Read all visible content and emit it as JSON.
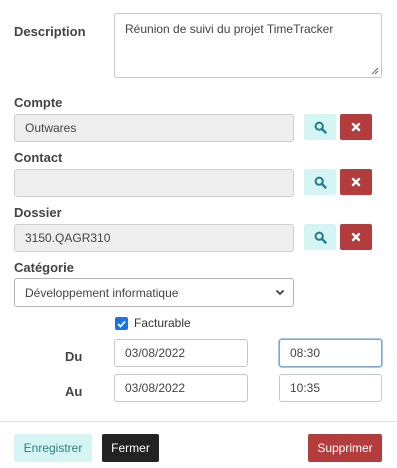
{
  "description": {
    "label": "Description",
    "value": "Réunion de suivi du projet TimeTracker"
  },
  "compte": {
    "label": "Compte",
    "value": "Outwares"
  },
  "contact": {
    "label": "Contact",
    "value": ""
  },
  "dossier": {
    "label": "Dossier",
    "value": "3150.QAGR310"
  },
  "categorie": {
    "label": "Catégorie",
    "selected": "Développement informatique"
  },
  "facturable": {
    "label": "Facturable",
    "checked": true
  },
  "du": {
    "label": "Du",
    "date": "03/08/2022",
    "time": "08:30"
  },
  "au": {
    "label": "Au",
    "date": "03/08/2022",
    "time": "10:35"
  },
  "buttons": {
    "save": "Enregistrer",
    "close": "Fermer",
    "delete": "Supprimer"
  },
  "colors": {
    "save_bg": "#d5f4f4",
    "save_text": "#2a7f7f",
    "close_bg": "#222222",
    "delete_bg": "#b33c3c",
    "checkbox": "#1a73e8"
  },
  "icons": {
    "search": "search-icon",
    "clear": "close-icon",
    "dropdown": "chevron-down-icon",
    "check": "check-icon"
  }
}
